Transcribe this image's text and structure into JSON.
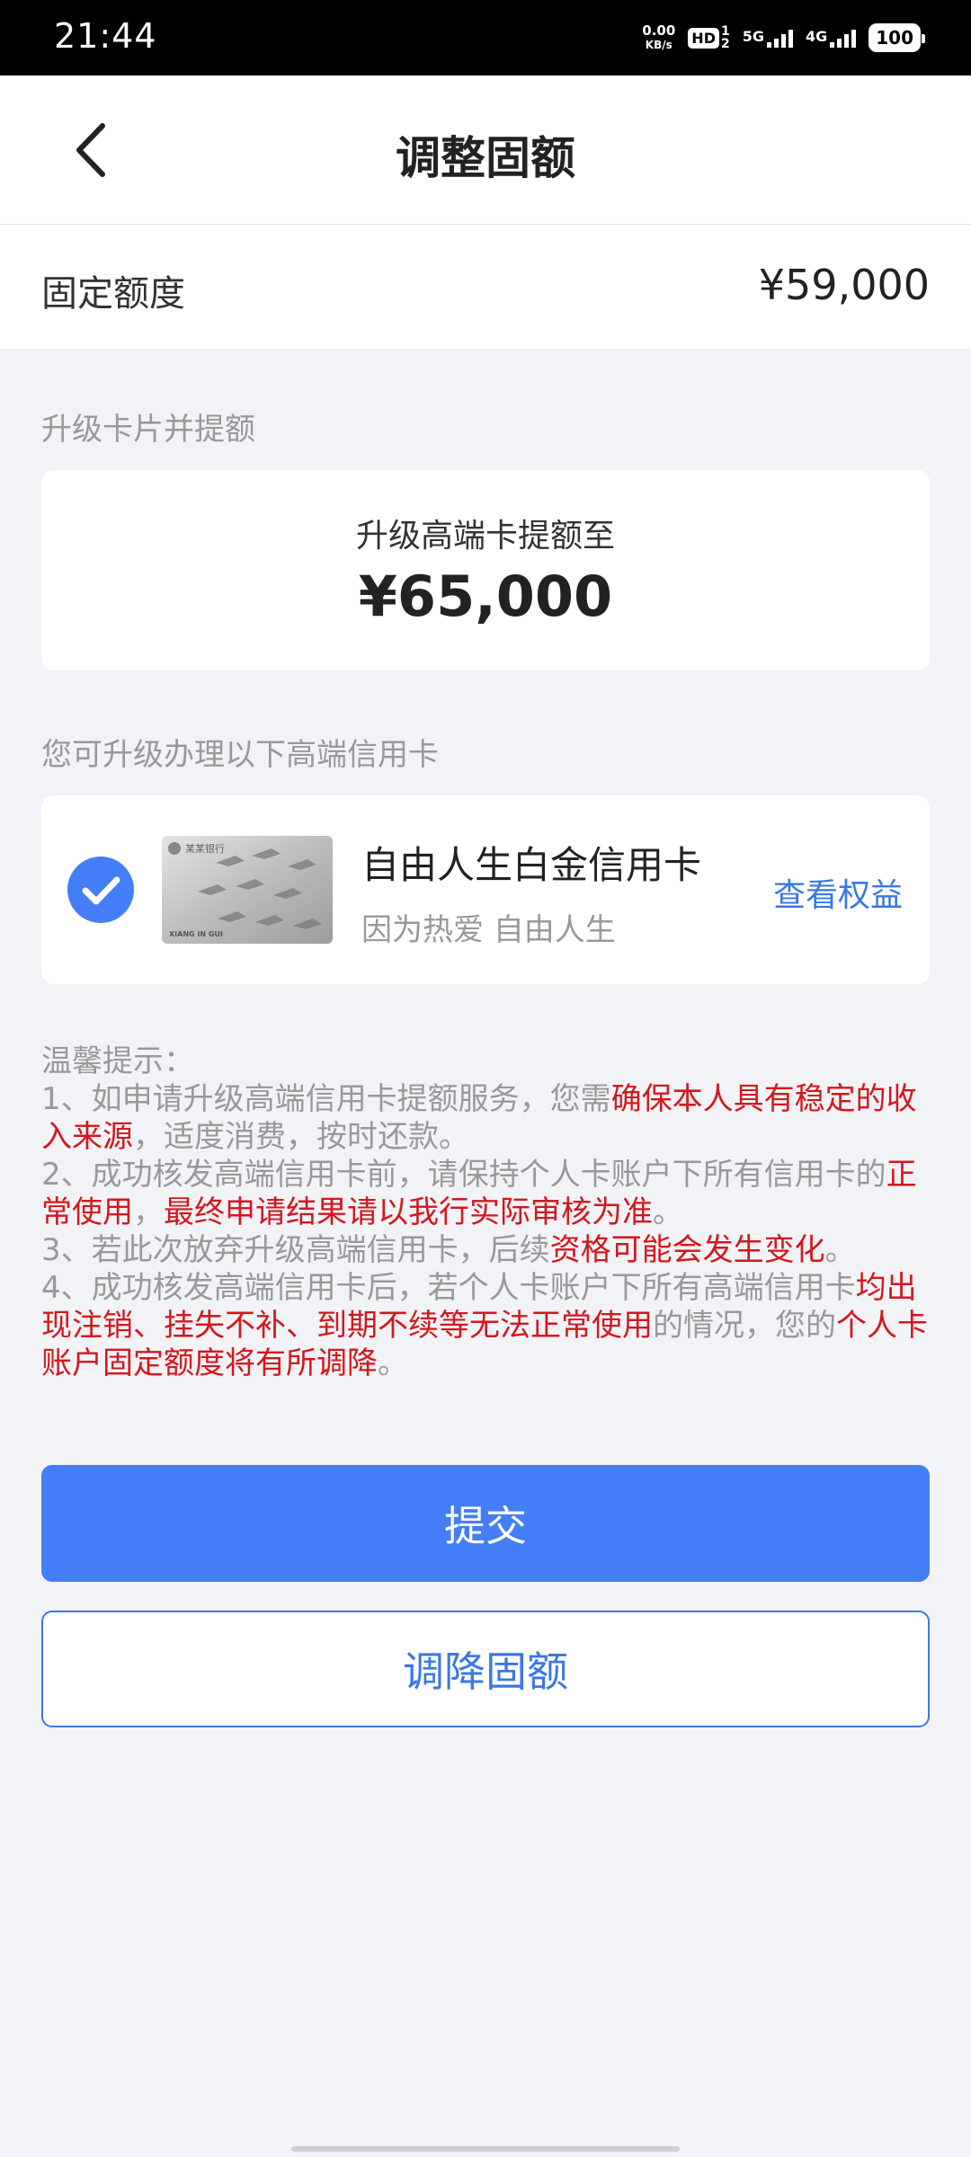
{
  "status_bar": {
    "time": "21:44",
    "net_speed_value": "0.00",
    "net_speed_unit": "KB/s",
    "hd": "HD",
    "sim_top": "1",
    "sim_bottom": "2",
    "signal1_label": "5G",
    "signal2_label": "4G",
    "battery": "100"
  },
  "header": {
    "title": "调整固额"
  },
  "fixed_quota": {
    "label": "固定额度",
    "value": "¥59,000"
  },
  "upgrade_section": {
    "label": "升级卡片并提额",
    "caption": "升级高端卡提额至",
    "amount": "¥65,000"
  },
  "card_section": {
    "label": "您可升级办理以下高端信用卡",
    "card_name": "自由人生白金信用卡",
    "card_slogan": "因为热爱 自由人生",
    "benefits_link": "查看权益",
    "card_brand_text": "某某银行",
    "card_holder_text": "XIANG IN GUI"
  },
  "tips": {
    "title": "温馨提示：",
    "t1_a": "1、如申请升级高端信用卡提额服务，您需",
    "t1_red": "确保本人具有稳定的收入来源",
    "t1_b": "，适度消费，按时还款。",
    "t2_a": "2、成功核发高端信用卡前，请保持个人卡账户下所有信用卡的",
    "t2_red1": "正常使用",
    "t2_b": "，",
    "t2_red2": "最终申请结果请以我行实际审核为准",
    "t2_c": "。",
    "t3_a": "3、若此次放弃升级高端信用卡，后续",
    "t3_red": "资格可能会发生变化",
    "t3_b": "。",
    "t4_a": "4、成功核发高端信用卡后，若个人卡账户下所有高端信用卡",
    "t4_red1": "均出现注销、挂失不补、到期不续等无法正常使用",
    "t4_b": "的情况，您的",
    "t4_red2": "个人卡账户固定额度将有所调降",
    "t4_c": "。"
  },
  "actions": {
    "submit_label": "提交",
    "reduce_label": "调降固额"
  },
  "colors": {
    "primary": "#437ef6",
    "link": "#3b78e2",
    "warning_red": "#d4171d",
    "background": "#f2f3f7"
  }
}
